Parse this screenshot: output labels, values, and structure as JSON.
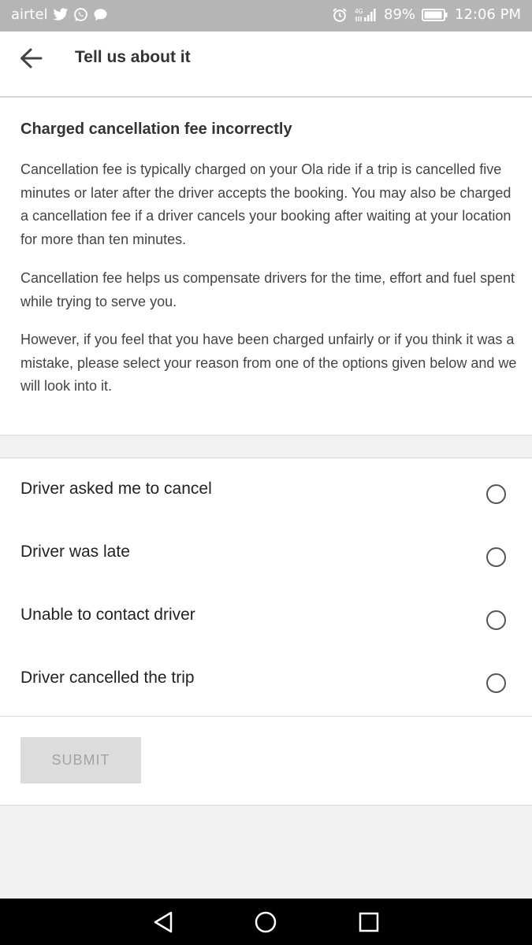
{
  "status_bar": {
    "carrier": "airtel",
    "network_type": "4G",
    "battery": "89%",
    "time": "12:06 PM",
    "left_icons": [
      "twitter-icon",
      "whatsapp-icon",
      "chat-bubble-icon"
    ],
    "right_icons": [
      "alarm-icon",
      "signal-icon",
      "battery-icon"
    ]
  },
  "header": {
    "title": "Tell us about it",
    "back_icon": "arrow-left-icon"
  },
  "info": {
    "heading": "Charged cancellation fee incorrectly",
    "paragraphs": [
      "Cancellation fee is typically charged on your Ola ride if a trip is cancelled five minutes or later after the driver accepts the booking. You may also be charged a cancellation fee if a driver cancels your booking after waiting at your location for more than ten minutes.",
      "Cancellation fee helps us compensate drivers for the time, effort and fuel spent while trying to serve you.",
      "However, if you feel that you have been charged unfairly or if you think it was a mistake, please select your reason from one of the options given below and we will look into it."
    ]
  },
  "options": [
    {
      "label": "Driver asked me to cancel",
      "selected": false
    },
    {
      "label": "Driver was late",
      "selected": false
    },
    {
      "label": "Unable to contact driver",
      "selected": false
    },
    {
      "label": "Driver cancelled the trip",
      "selected": false
    }
  ],
  "submit": {
    "label": "SUBMIT",
    "enabled": false
  },
  "nav_bar": {
    "buttons": [
      "back-triangle-icon",
      "home-circle-icon",
      "recents-square-icon"
    ]
  },
  "colors": {
    "status_bar_bg": "#b5b5b5",
    "page_bg": "#f2f2f2",
    "card_bg": "#ffffff",
    "submit_disabled_bg": "#dcdcdc",
    "submit_disabled_text": "#a3a3a3",
    "nav_bar_bg": "#000000"
  }
}
